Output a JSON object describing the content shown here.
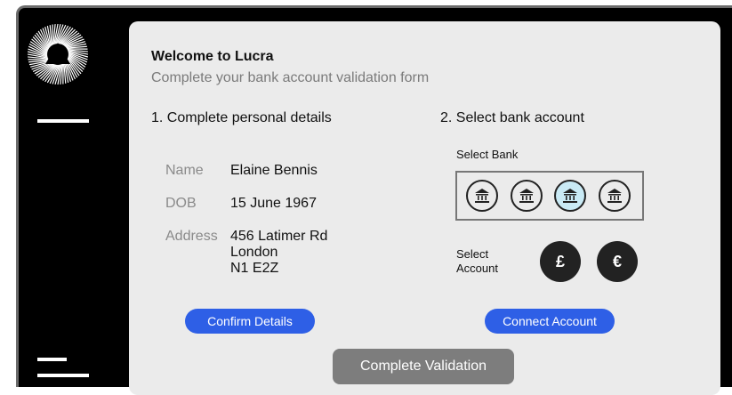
{
  "header": {
    "welcome": "Welcome to Lucra",
    "subtitle": "Complete your bank account validation form"
  },
  "personal": {
    "title": "1. Complete personal details",
    "name_label": "Name",
    "name_value": "Elaine Bennis",
    "dob_label": "DOB",
    "dob_value": "15 June 1967",
    "address_label": "Address",
    "address_lines": [
      "456 Latimer Rd",
      "London",
      "N1 E2Z"
    ],
    "confirm_button": "Confirm Details"
  },
  "bank": {
    "title": "2. Select bank account",
    "select_bank_label": "Select Bank",
    "banks": [
      {
        "icon": "bank-icon",
        "selected": false
      },
      {
        "icon": "bank-icon",
        "selected": false
      },
      {
        "icon": "bank-icon",
        "selected": true
      },
      {
        "icon": "bank-icon",
        "selected": false
      }
    ],
    "select_account_label_1": "Select",
    "select_account_label_2": "Account",
    "currencies": [
      "£",
      "€"
    ],
    "connect_button": "Connect Account"
  },
  "footer": {
    "complete_button": "Complete Validation"
  },
  "colors": {
    "accent_blue": "#2e5fe6",
    "selected_bank": "#c9eaf5",
    "panel": "#ebebeb"
  }
}
